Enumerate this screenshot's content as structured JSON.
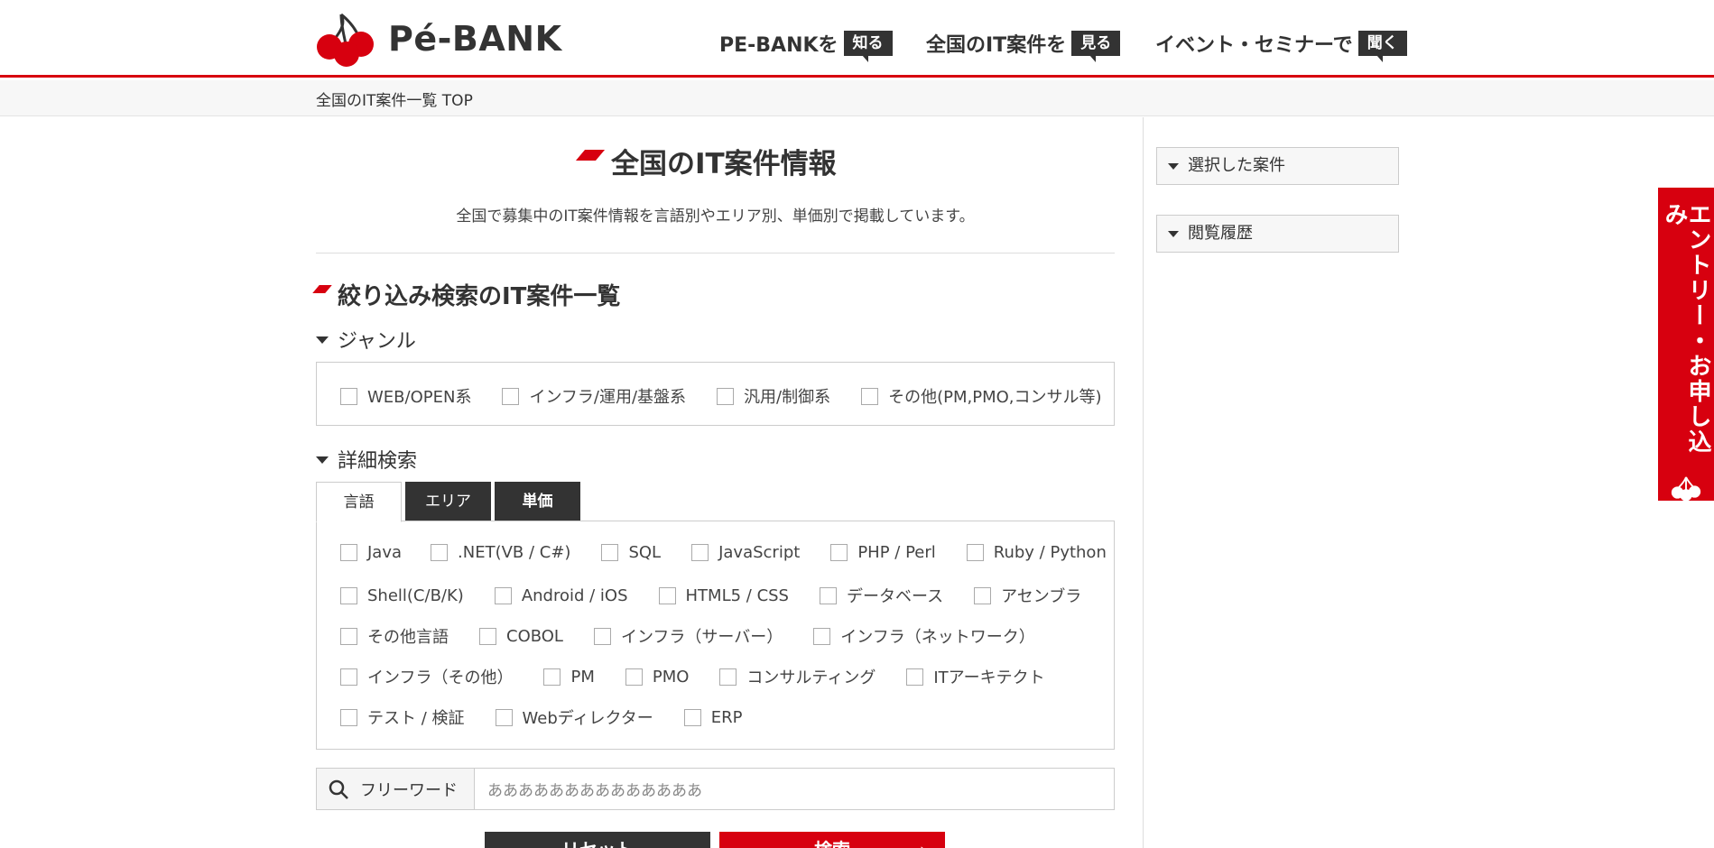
{
  "header": {
    "logo_text": "Pé-BANK",
    "nav": [
      {
        "text": "PE-BANKを",
        "badge": "知る"
      },
      {
        "text": "全国のIT案件を",
        "badge": "見る"
      },
      {
        "text": "イベント・セミナーで",
        "badge": "聞く"
      }
    ]
  },
  "breadcrumb": "全国のIT案件一覧 TOP",
  "main": {
    "title": "全国のIT案件情報",
    "lead": "全国で募集中のIT案件情報を言語別やエリア別、単価別で掲載しています。",
    "section_title": "絞り込み検索のIT案件一覧",
    "genre_heading": "ジャンル",
    "genres": [
      "WEB/OPEN系",
      "インフラ/運用/基盤系",
      "汎用/制御系",
      "その他(PM,PMO,コンサル等)"
    ],
    "detail_heading": "詳細検索",
    "tabs": [
      "言語",
      "エリア",
      "単価"
    ],
    "languages": [
      [
        "Java",
        ".NET(VB / C#)",
        "SQL",
        "JavaScript",
        "PHP / Perl",
        "Ruby / Python"
      ],
      [
        "Shell(C/B/K)",
        "Android / iOS",
        "HTML5 / CSS",
        "データベース",
        "アセンブラ"
      ],
      [
        "その他言語",
        "COBOL",
        "インフラ（サーバー）",
        "インフラ（ネットワーク）"
      ],
      [
        "インフラ（その他）",
        "PM",
        "PMO",
        "コンサルティング",
        "ITアーキテクト"
      ],
      [
        "テスト / 検証",
        "Webディレクター",
        "ERP"
      ]
    ],
    "freeword_label": "フリーワード",
    "freeword_value": "ああああああああああああああ",
    "reset_label": "リセット",
    "search_label": "検索"
  },
  "sidebar": {
    "selected": "選択した案件",
    "history": "閲覧履歴"
  },
  "entry_banner": "エントリー・お申し込み",
  "colors": {
    "accent": "#d7000f",
    "dark": "#333333"
  }
}
